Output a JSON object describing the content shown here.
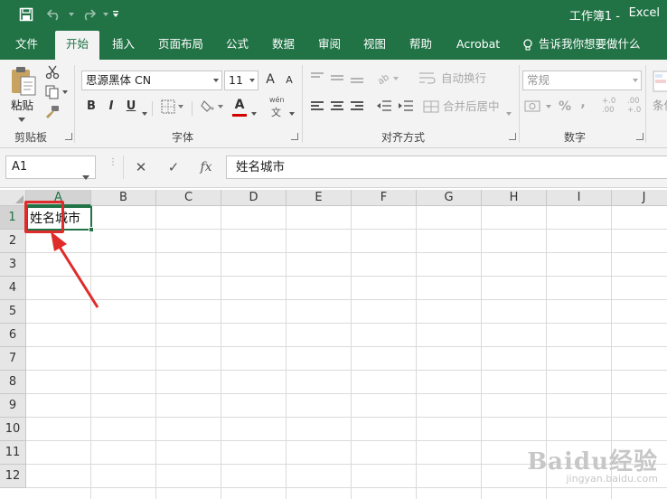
{
  "window": {
    "document_title": "工作簿1  -",
    "app_name": "Excel",
    "brand_color": "#217346"
  },
  "quick_access": [
    "save-icon",
    "undo-icon",
    "redo-icon",
    "customize-icon"
  ],
  "tabs": [
    {
      "label": "文件",
      "active": false
    },
    {
      "label": "开始",
      "active": true
    },
    {
      "label": "插入",
      "active": false
    },
    {
      "label": "页面布局",
      "active": false
    },
    {
      "label": "公式",
      "active": false
    },
    {
      "label": "数据",
      "active": false
    },
    {
      "label": "审阅",
      "active": false
    },
    {
      "label": "视图",
      "active": false
    },
    {
      "label": "帮助",
      "active": false
    },
    {
      "label": "Acrobat",
      "active": false
    },
    {
      "label": "告诉我你想要做什么",
      "active": false
    }
  ],
  "ribbon": {
    "clipboard": {
      "paste_label": "粘贴",
      "group_label": "剪贴板"
    },
    "font": {
      "font_name": "思源黑体 CN",
      "font_size": "11",
      "grow_label": "A",
      "shrink_label": "A",
      "bold_label": "B",
      "italic_label": "I",
      "underline_label": "U",
      "font_color_label": "A",
      "font_color": "#d40000",
      "phonetic_label": "wén",
      "group_label": "字体"
    },
    "alignment": {
      "wrap_text_label": "自动换行",
      "merge_center_label": "合并后居中",
      "group_label": "对齐方式"
    },
    "number": {
      "format_value": "常规",
      "percent_label": "%",
      "comma_label": ",",
      "inc_decimal_label": "+.0 .00",
      "dec_decimal_label": ".00 +.0",
      "group_label": "数字"
    },
    "styles": {
      "conditional_label": "条件"
    }
  },
  "formula_bar": {
    "name_box": "A1",
    "cancel_label": "✕",
    "enter_label": "✓",
    "fx_label": "fx",
    "value": "姓名城市"
  },
  "grid": {
    "columns": [
      "A",
      "B",
      "C",
      "D",
      "E",
      "F",
      "G",
      "H",
      "I",
      "J"
    ],
    "rows": [
      "1",
      "2",
      "3",
      "4",
      "5",
      "6",
      "7",
      "8",
      "9",
      "10",
      "11",
      "12"
    ],
    "active_cell": "A1",
    "a1_value": "姓名城市"
  },
  "annotation": {
    "color": "#e02b2b"
  },
  "watermark": {
    "logo": "Baidu经验",
    "url": "jingyan.baidu.com"
  }
}
